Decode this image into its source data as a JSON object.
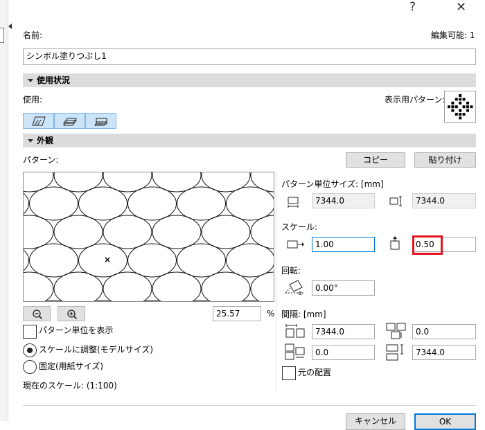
{
  "window": {
    "help_glyph": "?",
    "close_glyph": "✕"
  },
  "name": {
    "label": "名前:",
    "value": "シンボル塗りつぶし1",
    "editable_label": "編集可能: 1"
  },
  "usage": {
    "section_title": "使用状況",
    "label": "使用:",
    "display_pattern_label": "表示用パターン:",
    "icons": [
      "drafting-fill-icon",
      "cover-fill-icon",
      "cut-fill-icon"
    ]
  },
  "appearance": {
    "section_title": "外観",
    "pattern_label": "パターン:",
    "copy_button": "コピー",
    "paste_button": "貼り付け",
    "unit_size_label": "パターン単位サイズ: [mm]",
    "unit_width": "7344.0",
    "unit_height": "7344.0",
    "scale_label": "スケール:",
    "scale_x": "1.00",
    "scale_y": "0.50",
    "rotation_label": "回転:",
    "rotation": "0.00°",
    "spacing_label": "間隔: [mm]",
    "spacing_h": "7344.0",
    "spacing_offset_x": "0.0",
    "spacing_offset_y": "0.0",
    "spacing_v": "7344.0",
    "original_placement_label": "元の配置",
    "zoom_value": "25.57",
    "zoom_unit": "%",
    "show_unit_label": "パターン単位を表示",
    "scale_model_label": "スケールに調整(モデルサイズ)",
    "fixed_paper_label": "固定(用紙サイズ)",
    "current_scale_label": "現在のスケール: (1:100)"
  },
  "footer": {
    "cancel_button": "キャンセル",
    "ok_button": "OK"
  },
  "colors": {
    "section_bg": "#dcdcdc",
    "selected_bg": "#cce4f7",
    "highlight": "#e0141e",
    "focus_border": "#0078d7"
  }
}
